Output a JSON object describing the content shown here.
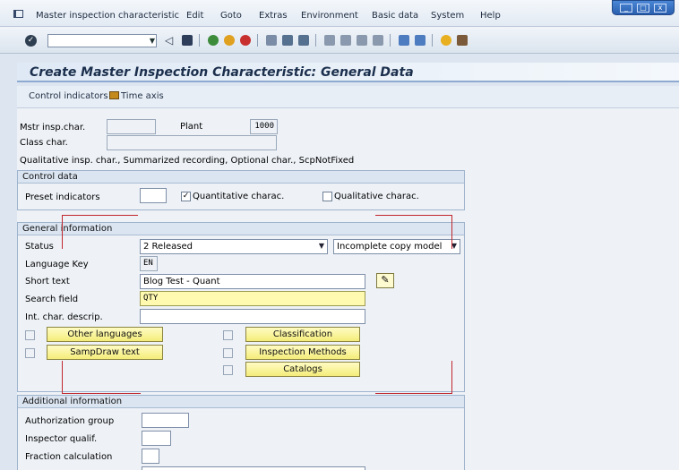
{
  "menu": {
    "items": [
      "Master inspection characteristic",
      "Edit",
      "Goto",
      "Extras",
      "Environment",
      "Basic data",
      "System",
      "Help"
    ]
  },
  "window_controls": {
    "minimize": "_",
    "restore": "□",
    "close": "x"
  },
  "toolbar": {
    "command_field": {
      "value": "",
      "placeholder": ""
    },
    "icons": [
      "enter-icon",
      "back-icon",
      "save-icon",
      "back-nav-icon",
      "exit-icon",
      "cancel-icon",
      "print-icon",
      "find-icon",
      "find-next-icon",
      "first-page-icon",
      "prev-page-icon",
      "next-page-icon",
      "last-page-icon",
      "create-session-icon",
      "shortcut-icon",
      "help-icon",
      "layout-icon"
    ]
  },
  "title": "Create Master Inspection Characteristic: General Data",
  "app_toolbar": {
    "control_indicators": "Control indicators",
    "time_axis": "Time axis"
  },
  "header": {
    "mstr_label": "Mstr insp.char.",
    "mstr_value": "",
    "plant_label": "Plant",
    "plant_value": "1000",
    "class_label": "Class char.",
    "class_value": "",
    "summary": "Qualitative insp. char., Summarized recording, Optional char., ScpNotFixed"
  },
  "control_data": {
    "header": "Control data",
    "preset_label": "Preset indicators",
    "preset_value": "",
    "quantitative_label": "Quantitative charac.",
    "quantitative_checked": true,
    "qualitative_label": "Qualitative charac.",
    "qualitative_checked": false
  },
  "general_info": {
    "header": "General information",
    "status_label": "Status",
    "status_value": "2 Released",
    "copy_model_value": "Incomplete copy model",
    "language_label": "Language Key",
    "language_value": "EN",
    "short_text_label": "Short text",
    "short_text_value": "Blog Test - Quant",
    "search_label": "Search field",
    "search_value": "QTY",
    "int_descr_label": "Int. char. descrip.",
    "int_descr_value": "",
    "buttons": {
      "other_languages": "Other languages",
      "sampdraw_text": "SampDraw text",
      "classification": "Classification",
      "inspection_methods": "Inspection Methods",
      "catalogs": "Catalogs"
    }
  },
  "additional_info": {
    "header": "Additional information",
    "auth_label": "Authorization group",
    "auth_value": "",
    "inspector_label": "Inspector qualif.",
    "inspector_value": "",
    "fraction_label": "Fraction calculation",
    "fraction_value": ""
  },
  "colors": {
    "annotation_red": "#c0262c",
    "required_yellow": "#fffab0",
    "button_yellow": "#f4ec7a"
  }
}
